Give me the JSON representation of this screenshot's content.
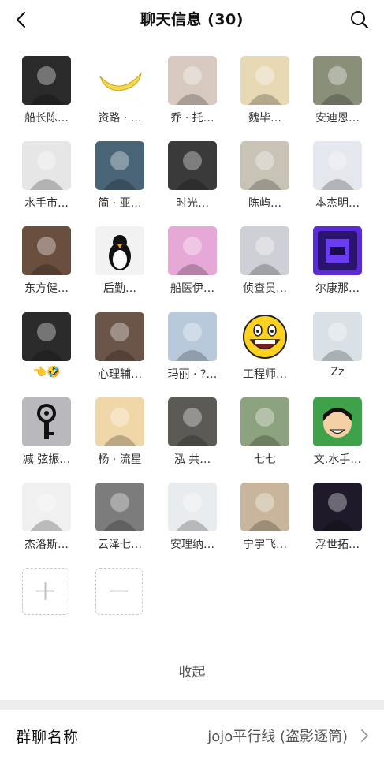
{
  "header": {
    "title": "聊天信息 (30)"
  },
  "members": [
    {
      "name": "船长陈…",
      "avatar": "dark-gray-portrait",
      "color": "#2a2a2a"
    },
    {
      "name": "资路 · …",
      "avatar": "banana",
      "color": "#f5d94a"
    },
    {
      "name": "乔 · 托…",
      "avatar": "anime-boy-gray-hair",
      "color": "#d8c9c0"
    },
    {
      "name": "魏毕…",
      "avatar": "anime-group",
      "color": "#e8d9b5"
    },
    {
      "name": "安迪恩…",
      "avatar": "cat-photo",
      "color": "#8a8f7a"
    },
    {
      "name": "水手市…",
      "avatar": "manga-sketch",
      "color": "#e6e6e6"
    },
    {
      "name": "简 · 亚…",
      "avatar": "man-with-phone",
      "color": "#4a6478"
    },
    {
      "name": "时光…",
      "avatar": "bw-eye-figure",
      "color": "#3a3a3a"
    },
    {
      "name": "陈屿…",
      "avatar": "anime-girl-sketch",
      "color": "#c9c3b6"
    },
    {
      "name": "本杰明…",
      "avatar": "white-hair-figure",
      "color": "#e4e7ee"
    },
    {
      "name": "东方健…",
      "avatar": "man-sitting-room",
      "color": "#6a4e3e"
    },
    {
      "name": "后勤…",
      "avatar": "penguin",
      "color": "#f2f2f2"
    },
    {
      "name": "船医伊…",
      "avatar": "pink-hair-anime",
      "color": "#e6a8d6"
    },
    {
      "name": "侦查员…",
      "avatar": "anime-boy-dark-hair",
      "color": "#cfcfd8"
    },
    {
      "name": "尔康那…",
      "avatar": "purple-logo",
      "color": "#5b2bd6"
    },
    {
      "name": "👈🤣",
      "avatar": "bw-boy-portrait",
      "color": "#2b2b2b"
    },
    {
      "name": "心理辅…",
      "avatar": "doll-figure",
      "color": "#6b5448"
    },
    {
      "name": "玛丽 · ?…",
      "avatar": "anime-girl-blue",
      "color": "#b9c9dc"
    },
    {
      "name": "工程师…",
      "avatar": "big-smile-emoji",
      "color": "#ffd21f"
    },
    {
      "name": "Zz",
      "avatar": "nurse-photo",
      "color": "#d9e1e6"
    },
    {
      "name": "减 弦振…",
      "avatar": "key-symbol",
      "color": "#b9b9bd"
    },
    {
      "name": "杨 · 流星",
      "avatar": "anime-blonde-boy",
      "color": "#f0d7a8"
    },
    {
      "name": "泓 共…",
      "avatar": "duck-on-tree",
      "color": "#5b5a55"
    },
    {
      "name": "七七",
      "avatar": "flowers-anime",
      "color": "#8da27f"
    },
    {
      "name": "文.水手…",
      "avatar": "green-cartoon-boy",
      "color": "#3fa14a"
    },
    {
      "name": "杰洛斯…",
      "avatar": "sketch-boy",
      "color": "#f0f0f0"
    },
    {
      "name": "云泽七…",
      "avatar": "bw-anime-girl",
      "color": "#7c7c7c"
    },
    {
      "name": "安理纳…",
      "avatar": "white-hair-anime",
      "color": "#e9ecef"
    },
    {
      "name": "宁宇飞…",
      "avatar": "dog-with-hat",
      "color": "#c8b59b"
    },
    {
      "name": "浮世拓…",
      "avatar": "ultraman",
      "color": "#1e1a2a"
    }
  ],
  "actions": {
    "add_icon": "plus-icon",
    "remove_icon": "minus-icon"
  },
  "collapse_label": "收起",
  "group_name": {
    "label": "群聊名称",
    "value": "jojo平行线 (盗影逐筒)"
  },
  "colors": {
    "divider": "#ededed",
    "dashed_border": "#c8c8c8",
    "secondary_text": "#555555"
  }
}
